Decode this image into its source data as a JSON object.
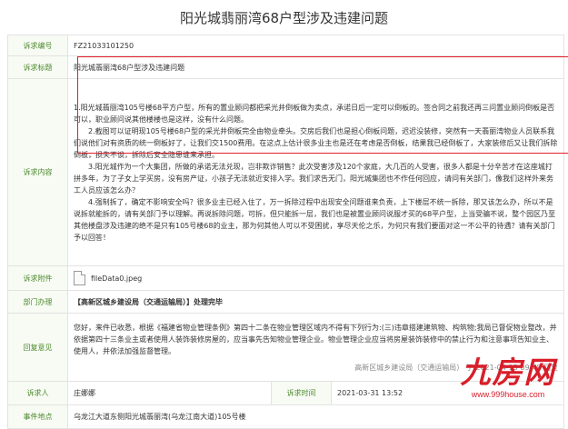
{
  "page": {
    "title": "阳光城翡丽湾68户型涉及违建问题"
  },
  "rows": {
    "number": {
      "label": "诉求编号",
      "value": "FZ21033101250"
    },
    "subject": {
      "label": "诉求标题",
      "value": "阳光城翡丽湾68户型涉及违建问题"
    },
    "content": {
      "label": "诉求内容",
      "paragraphs": [
        "1.阳光城翡丽湾105号楼68平方户型，所有的置业顾问都把采光井倒板做为卖点，承诺日后一定可以倒板的。签合同之前我还再三问置业顾问倒板是否可以，职业顾问说其他楼楼也是这样，没有什么问题。",
        "2.截图可以证明现105号楼68户型的采光井倒板完全由物业牵头。交房后我们也是担心倒板问题，迟迟没装修，突然有一天翡丽湾物业人员联系我们说他们对有资质的统一倒板好了，让我们交1500费用。在这点上估计很多业主也是还在考虑是否倒板，结果我已经倒板了，大家装修后又让我们拆除倒板，损失不谈，拆除后安全隐患谁来承担。",
        "3.阳光城作为一个大集团，所做的承诺无法兑现，岂非欺诈销售？此次受害涉及120个家庭，大几百的人受害，很多人都是十分辛苦才在这座城打拼多年，为了子女上学买房，没有房产证，小孩子无法就近安排入学。我们求告无门，阳光城集团也不作任何回应，请问有关部门，像我们这样外来务工人员应该怎么办？",
        "4.强制拆了，确定不影响安全吗？很多业主已经入住了，万一拆除过程中出现安全问题谁来负责，上下楼层不统一拆除，那又该怎么办，所以不是说拆就能拆的，请有关部门予以理解。再说拆除问题，可拆，但只能拆一层，我们也是被置业顾问说服才买的68平户型，上当受骗不说，整个园区乃至其他楼盘涉及违建的绝不是只有105号楼68的业主，那为何其他人可以不受困扰，享尽天伦之乐，为何只有我们要面对这一不公平的待遇？请有关部门予以回答！"
      ]
    },
    "attachment": {
      "label": "诉求附件",
      "file": "fileData0.jpeg"
    },
    "handling": {
      "label": "部门办理",
      "department": "【高新区城乡建设局（交通运输局）】处理完毕"
    },
    "reply": {
      "label": "回复意见",
      "text": "您好，来件已收悉，根据《福建省物业管理条例》第四十二条在物业管理区域内不得有下列行为:(三)违章搭建建筑物、构筑物;我局已督促物业整改，并依据第四十三条业主或者使用人装饰装修房屋的，应当事先告知物业管理企业。物业管理企业应当将房屋装饰装修中的禁止行为和注意事项告知业主、使用人，并依法加强监督管理。",
      "signature": "高新区城乡建设局（交通运输局）   于 2021-04-15 09:48 回复"
    },
    "petitioner": {
      "label": "诉求人",
      "value": "庄娜娜"
    },
    "time": {
      "label": "诉求时间",
      "value": "2021-03-31 13:52"
    },
    "location": {
      "label": "事件地点",
      "value": "乌龙江大道东侧阳光城翡丽湾(乌龙江南大道)105号楼"
    }
  },
  "watermark": {
    "logo": "九房网",
    "url": "www.999house.com"
  },
  "colors": {
    "label_bg": "#f7fbf3",
    "label_text": "#4e8a2f",
    "highlight": "#e0202a"
  }
}
